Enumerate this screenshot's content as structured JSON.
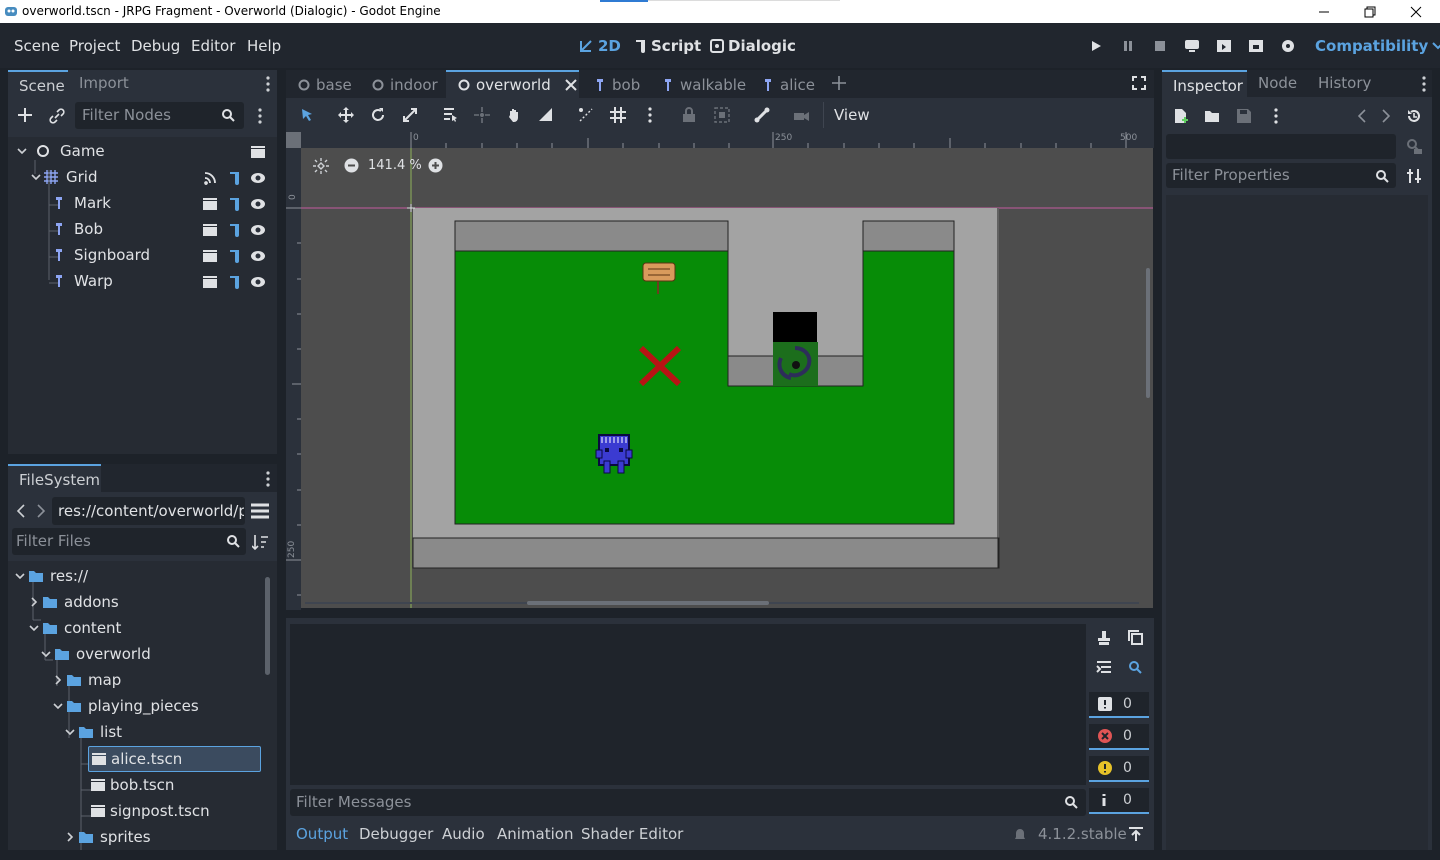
{
  "window": {
    "title": "overworld.tscn - JRPG Fragment - Overworld (Dialogic) - Godot Engine",
    "controls": [
      "minimize-icon",
      "restore-icon",
      "close-icon"
    ]
  },
  "menubar": {
    "items": [
      "Scene",
      "Project",
      "Debug",
      "Editor",
      "Help"
    ],
    "workspaces": {
      "two_d": "2D",
      "script": "Script",
      "dialogic": "Dialogic"
    },
    "renderer": "Compatibility"
  },
  "scene_dock": {
    "tabs": [
      "Scene",
      "Import"
    ],
    "filter_placeholder": "Filter Nodes",
    "tree": [
      {
        "label": "Game",
        "indent": 0
      },
      {
        "label": "Grid",
        "indent": 1
      },
      {
        "label": "Mark",
        "indent": 2
      },
      {
        "label": "Bob",
        "indent": 2
      },
      {
        "label": "Signboard",
        "indent": 2
      },
      {
        "label": "Warp",
        "indent": 2
      }
    ]
  },
  "filesystem": {
    "tab": "FileSystem",
    "path": "res://content/overworld/pla",
    "filter_placeholder": "Filter Files",
    "tree": [
      {
        "label": "res://",
        "type": "folder"
      },
      {
        "label": "addons",
        "type": "folder"
      },
      {
        "label": "content",
        "type": "folder"
      },
      {
        "label": "overworld",
        "type": "folder"
      },
      {
        "label": "map",
        "type": "folder"
      },
      {
        "label": "playing_pieces",
        "type": "folder"
      },
      {
        "label": "list",
        "type": "folder"
      },
      {
        "label": "alice.tscn",
        "type": "scene"
      },
      {
        "label": "bob.tscn",
        "type": "scene"
      },
      {
        "label": "signpost.tscn",
        "type": "scene"
      },
      {
        "label": "sprites",
        "type": "folder"
      }
    ]
  },
  "editor_tabs": [
    "base",
    "indoor",
    "overworld",
    "bob",
    "walkable",
    "alice"
  ],
  "toolbar": {
    "view_label": "View"
  },
  "viewport": {
    "zoom": "141.4 %",
    "ruler_top": [
      "0",
      "250",
      "500"
    ],
    "ruler_left": [
      "0",
      "250"
    ]
  },
  "inspector": {
    "tabs": [
      "Inspector",
      "Node",
      "History"
    ],
    "filter_placeholder": "Filter Properties"
  },
  "output": {
    "filter_placeholder": "Filter Messages",
    "counts": {
      "messages": "0",
      "errors": "0",
      "warnings": "0",
      "info": "0"
    },
    "bottom_tabs": [
      "Output",
      "Debugger",
      "Audio",
      "Animation",
      "Shader Editor"
    ],
    "version": "4.1.2.stable"
  },
  "colors": {
    "accent": "#5ba3e0",
    "grass": "#078c07",
    "wall": "#a3a3a3",
    "bg": "#21262e"
  }
}
